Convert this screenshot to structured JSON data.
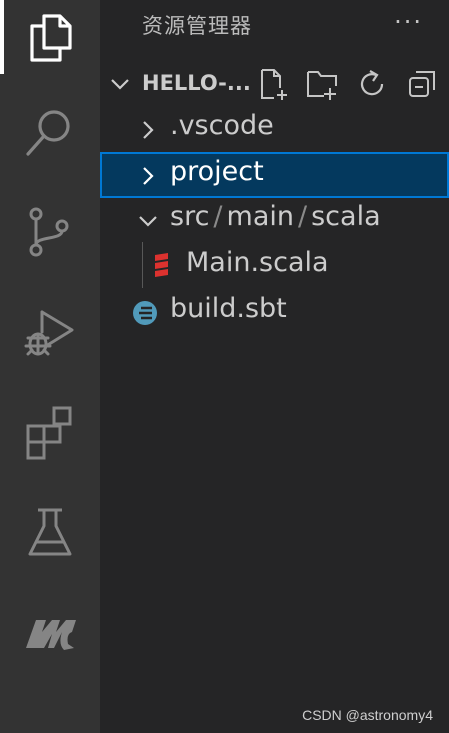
{
  "activity_bar": {
    "items": [
      {
        "name": "explorer",
        "icon": "files-icon",
        "active": true
      },
      {
        "name": "search",
        "icon": "search-icon"
      },
      {
        "name": "source-control",
        "icon": "source-control-icon"
      },
      {
        "name": "run-debug",
        "icon": "run-debug-icon"
      },
      {
        "name": "extensions",
        "icon": "extensions-icon"
      },
      {
        "name": "testing",
        "icon": "flask-icon"
      },
      {
        "name": "metals",
        "icon": "metals-icon"
      }
    ]
  },
  "explorer": {
    "title": "资源管理器",
    "more_label": "···",
    "section_title": "HELLO-...",
    "toolbar": [
      "new-file-icon",
      "new-folder-icon",
      "refresh-icon",
      "collapse-all-icon"
    ]
  },
  "tree": {
    "vscode": ".vscode",
    "project": "project",
    "src_path": [
      "src",
      "main",
      "scala"
    ],
    "separator": "/",
    "main_scala": "Main.scala",
    "build_sbt": "build.sbt"
  },
  "watermark": "CSDN @astronomy4",
  "colors": {
    "activity_bg": "#333333",
    "sidebar_bg": "#252526",
    "selection_bg": "#04395e",
    "focus_border": "#0078d4",
    "scala_red": "#dc322f",
    "sbt_blue": "#519aba"
  }
}
